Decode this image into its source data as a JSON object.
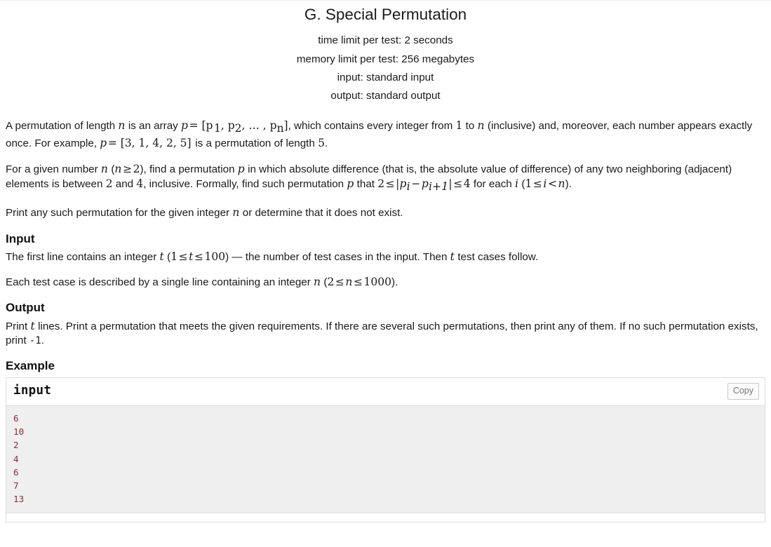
{
  "header": {
    "title": "G. Special Permutation",
    "time_limit": "time limit per test: 2 seconds",
    "memory_limit": "memory limit per test: 256 megabytes",
    "input_spec": "input: standard input",
    "output_spec": "output: standard output"
  },
  "legend": {
    "p1_a": "A permutation of length ",
    "p1_n": "n",
    "p1_b": " is an array ",
    "p1_eq1_p": "p",
    "p1_eq1_rest": "= [p",
    "p1_sub1": "1",
    "p1_eq1_c": ", p",
    "p1_sub2": "2",
    "p1_eq1_d": ", … , p",
    "p1_subn": "n",
    "p1_eq1_e": "]",
    "p1_c": ", which contains every integer from ",
    "p1_one": "1",
    "p1_d": " to ",
    "p1_n2": "n",
    "p1_e": " (inclusive) and, moreover, each number appears exactly once. For example, ",
    "p1_eq2_p": "p",
    "p1_eq2_rest": "= [3, 1, 4, 2, 5]",
    "p1_f": " is a permutation of length ",
    "p1_five": "5",
    "p1_g": ".",
    "p2_a": "For a given number ",
    "p2_n": "n",
    "p2_b": " (",
    "p2_cond_n": "n",
    "p2_cond_ge": "≥",
    "p2_cond_2": "2",
    "p2_c": "), find a permutation ",
    "p2_p": "p",
    "p2_d": " in which absolute difference (that is, the absolute value of difference) of any two neighboring (adjacent) elements is between ",
    "p2_two": "2",
    "p2_e": " and ",
    "p2_four": "4",
    "p2_f": ", inclusive. Formally, find such permutation ",
    "p2_p2": "p",
    "p2_g": " that ",
    "p2_ineq_2": "2",
    "p2_ineq_le1": "≤",
    "p2_ineq_abs1": "|p",
    "p2_ineq_sub_i": "i",
    "p2_ineq_minus": "−",
    "p2_ineq_p2": "p",
    "p2_ineq_sub_i1": "i+1",
    "p2_ineq_abs2": "|",
    "p2_ineq_le2": "≤",
    "p2_ineq_4": "4",
    "p2_h": " for each ",
    "p2_i": "i",
    "p2_j": " (",
    "p2_k_1": "1",
    "p2_k_le": "≤",
    "p2_k_i": "i",
    "p2_k_lt": "<",
    "p2_k_n": "n",
    "p2_l": ").",
    "p3_a": "Print any such permutation for the given integer ",
    "p3_n": "n",
    "p3_b": " or determine that it does not exist."
  },
  "input_section": {
    "heading": "Input",
    "p1_a": "The first line contains an integer ",
    "p1_t": "t",
    "p1_b": " (",
    "p1_one": "1",
    "p1_le1": "≤",
    "p1_t2": "t",
    "p1_le2": "≤",
    "p1_hundred": "100",
    "p1_c": ") — the number of test cases in the input. Then ",
    "p1_t3": "t",
    "p1_d": " test cases follow.",
    "p2_a": "Each test case is described by a single line containing an integer ",
    "p2_n": "n",
    "p2_b": " (",
    "p2_two": "2",
    "p2_le1": "≤",
    "p2_n2": "n",
    "p2_le2": "≤",
    "p2_thousand": "1000",
    "p2_c": ")."
  },
  "output_section": {
    "heading": "Output",
    "p1_a": "Print ",
    "p1_t": "t",
    "p1_b": " lines. Print a permutation that meets the given requirements. If there are several such permutations, then print any of them. If no such permutation exists, print ",
    "p1_minus1": "-1",
    "p1_c": "."
  },
  "example": {
    "heading": "Example",
    "input_label": "input",
    "copy_label": "Copy",
    "input_data": "6\n10\n2\n4\n6\n7\n13"
  },
  "colors": {
    "sample_text": "#8b2b3b",
    "sample_bg": "#efefef",
    "border": "#dddddd"
  }
}
